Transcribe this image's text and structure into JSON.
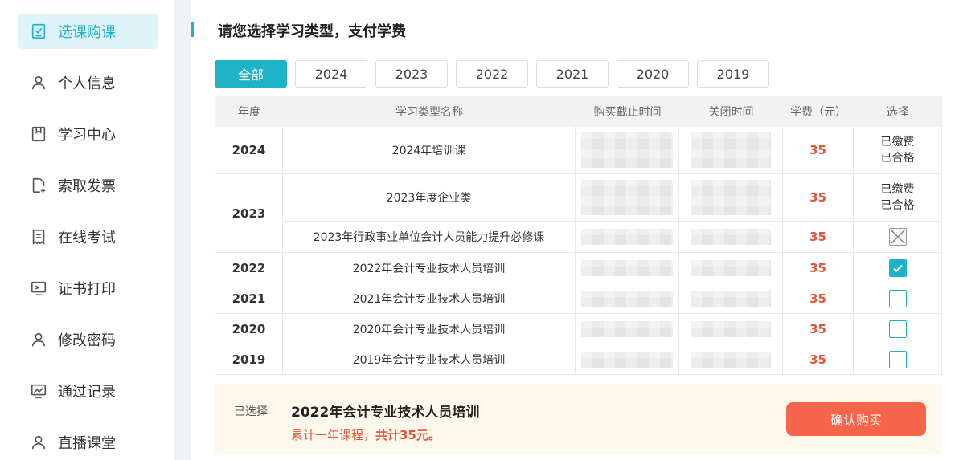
{
  "sidebar": {
    "items": [
      {
        "label": "选课购课",
        "icon": "checklist-icon",
        "active": true
      },
      {
        "label": "个人信息",
        "icon": "user-icon"
      },
      {
        "label": "学习中心",
        "icon": "bookmark-icon"
      },
      {
        "label": "索取发票",
        "icon": "invoice-add-icon"
      },
      {
        "label": "在线考试",
        "icon": "exam-paper-icon"
      },
      {
        "label": "证书打印",
        "icon": "certificate-monitor-icon"
      },
      {
        "label": "修改密码",
        "icon": "user-icon"
      },
      {
        "label": "通过记录",
        "icon": "chart-monitor-icon"
      },
      {
        "label": "直播课堂",
        "icon": "user-icon"
      }
    ]
  },
  "main": {
    "title": "请您选择学习类型，支付学费",
    "filters": [
      "全部",
      "2024",
      "2023",
      "2022",
      "2021",
      "2020",
      "2019"
    ],
    "active_filter": "全部",
    "table": {
      "headers": [
        "年度",
        "学习类型名称",
        "购买截止时间",
        "关闭时间",
        "学费（元）",
        "选择"
      ],
      "rows": [
        {
          "year": "2024",
          "name": "2024年培训课",
          "fee": "35",
          "status": [
            "已缴费",
            "已合格"
          ]
        },
        {
          "year": "2023",
          "name": "2023年度企业类",
          "fee": "35",
          "status": [
            "已缴费",
            "已合格"
          ]
        },
        {
          "year": "2023",
          "name": "2023年行政事业单位会计人员能力提升必修课",
          "fee": "35",
          "select": "disabled"
        },
        {
          "year": "2022",
          "name": "2022年会计专业技术人员培训",
          "fee": "35",
          "select": "checked"
        },
        {
          "year": "2021",
          "name": "2021年会计专业技术人员培训",
          "fee": "35",
          "select": "unchecked"
        },
        {
          "year": "2020",
          "name": "2020年会计专业技术人员培训",
          "fee": "35",
          "select": "unchecked"
        },
        {
          "year": "2019",
          "name": "2019年会计专业技术人员培训",
          "fee": "35",
          "select": "unchecked"
        }
      ]
    },
    "summary": {
      "label": "已选择",
      "selected": "2022年会计专业技术人员培训",
      "desc_prefix": "累计一年课程，",
      "desc_total": "共计35元。",
      "confirm_label": "确认购买"
    }
  },
  "colors": {
    "accent": "#1fb3c8",
    "price": "#e0573e",
    "confirm": "#f6644a"
  }
}
